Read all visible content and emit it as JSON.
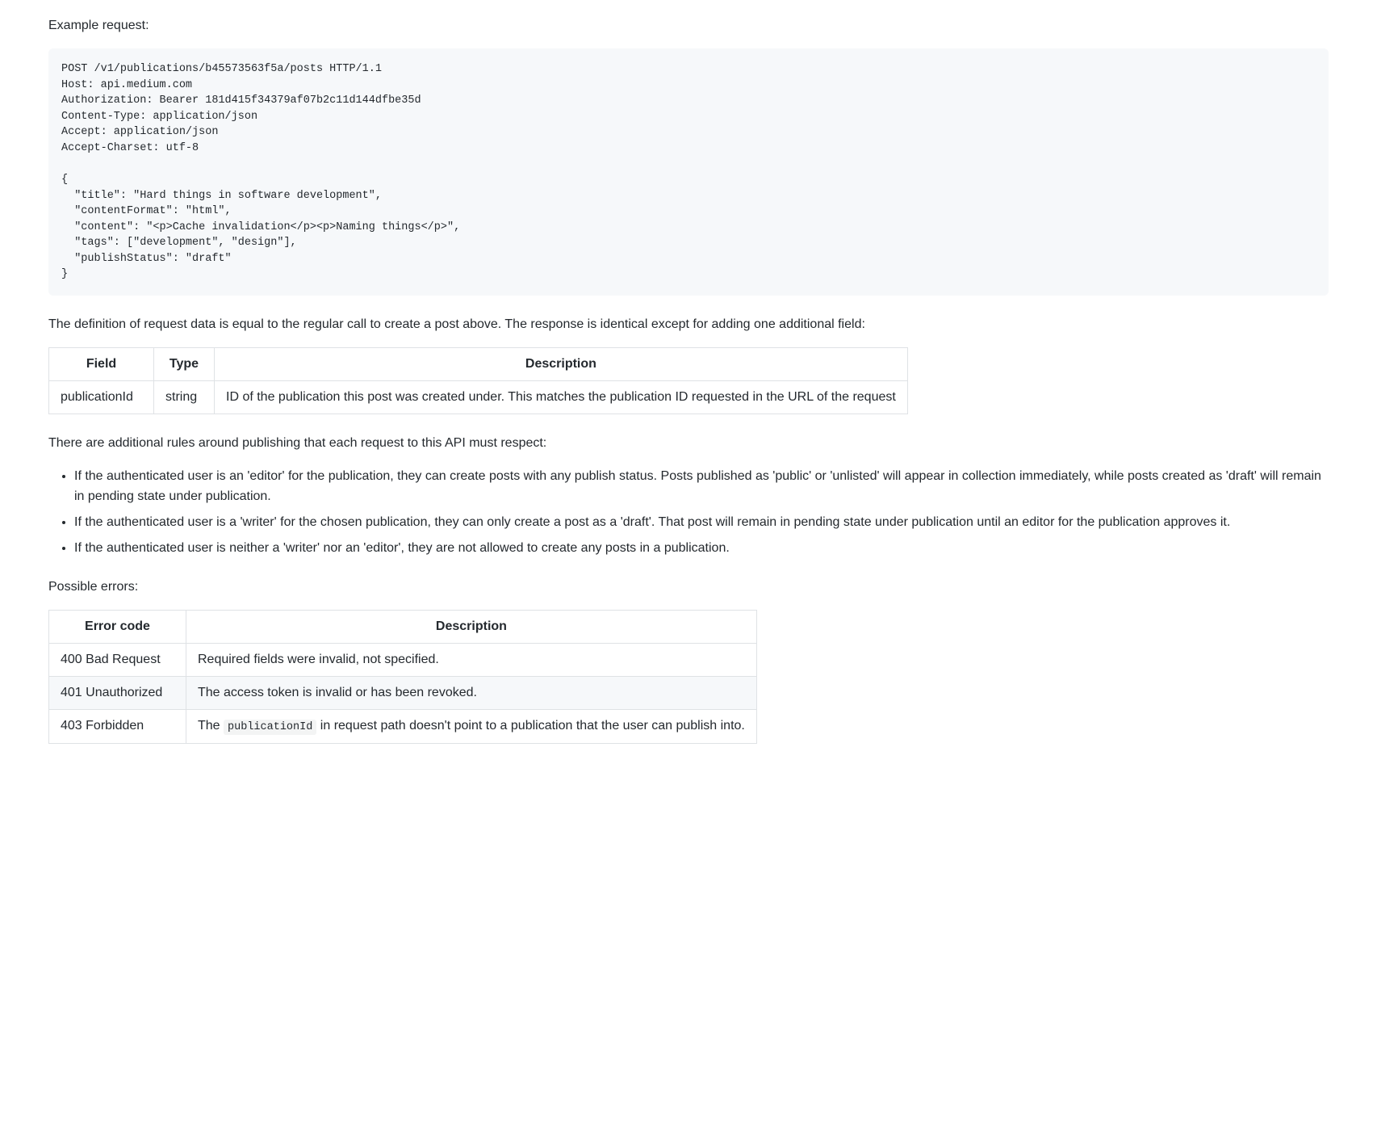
{
  "labels": {
    "example_request": "Example request:",
    "definition_text": "The definition of request data is equal to the regular call to create a post above. The response is identical except for adding one additional field:",
    "additional_rules": "There are additional rules around publishing that each request to this API must respect:",
    "possible_errors": "Possible errors:"
  },
  "code_block": "POST /v1/publications/b45573563f5a/posts HTTP/1.1\nHost: api.medium.com\nAuthorization: Bearer 181d415f34379af07b2c11d144dfbe35d\nContent-Type: application/json\nAccept: application/json\nAccept-Charset: utf-8\n\n{\n  \"title\": \"Hard things in software development\",\n  \"contentFormat\": \"html\",\n  \"content\": \"<p>Cache invalidation</p><p>Naming things</p>\",\n  \"tags\": [\"development\", \"design\"],\n  \"publishStatus\": \"draft\"\n}",
  "fields_table": {
    "headers": {
      "field": "Field",
      "type": "Type",
      "description": "Description"
    },
    "rows": [
      {
        "field": "publicationId",
        "type": "string",
        "description": "ID of the publication this post was created under. This matches the publication ID requested in the URL of the request"
      }
    ]
  },
  "rules": [
    "If the authenticated user is an 'editor' for the publication, they can create posts with any publish status. Posts published as 'public' or 'unlisted' will appear in collection immediately, while posts created as 'draft' will remain in pending state under publication.",
    "If the authenticated user is a 'writer' for the chosen publication, they can only create a post as a 'draft'. That post will remain in pending state under publication until an editor for the publication approves it.",
    "If the authenticated user is neither a 'writer' nor an 'editor', they are not allowed to create any posts in a publication."
  ],
  "errors_table": {
    "headers": {
      "code": "Error code",
      "description": "Description"
    },
    "rows": [
      {
        "code": "400 Bad Request",
        "description": "Required fields were invalid, not specified."
      },
      {
        "code": "401 Unauthorized",
        "description": "The access token is invalid or has been revoked."
      },
      {
        "code": "403 Forbidden",
        "desc_prefix": "The ",
        "inline_code": "publicationId",
        "desc_suffix": " in request path doesn't point to a publication that the user can publish into."
      }
    ]
  }
}
